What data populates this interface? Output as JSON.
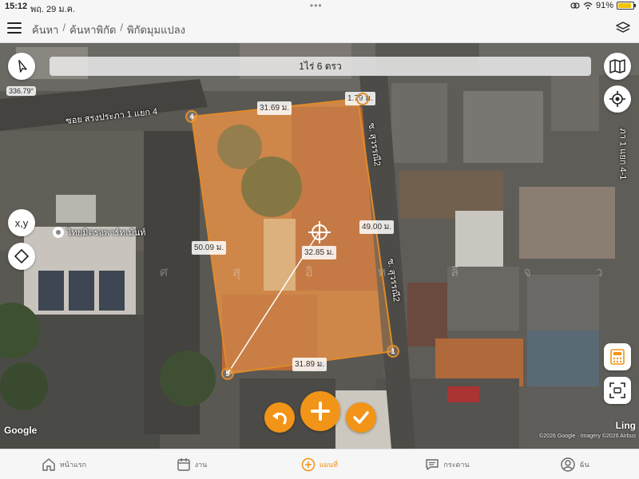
{
  "status_bar": {
    "time": "15:12",
    "date": "พฤ. 29 ม.ค.",
    "battery": "91%"
  },
  "nav": {
    "breadcrumb": [
      "ค้นหา",
      "ค้นหาพิกัด",
      "พิกัดมุมแปลง"
    ],
    "separator": "/"
  },
  "map": {
    "area_text": "1ไร่  6 ตรว",
    "heading": "336.79°",
    "xy_label": "x,y",
    "poi_label": "ไทยมิตรอพาร์ทเม้นท์",
    "streets": {
      "top_left": "ซอย สรงประภา 1 แยก 4",
      "right_upper": "ซ. สุวรรณี2",
      "right_lower": "ซ. สุวรรณี2",
      "far_right": "ภา 1 แยก 4-1"
    },
    "measurements": {
      "top": "31.69 ม.",
      "top_right": "1.79 ม.",
      "right": "49.00 ม.",
      "left": "50.09 ม.",
      "diagonal": "32.85 ม.",
      "bottom": "31.89 ม."
    },
    "vertices": [
      "4",
      "1",
      "5"
    ],
    "attribution_logo": "Google",
    "attribution_text": "©2026 Google · Imagery ©2026 Airbus",
    "corner_label": "Ling"
  },
  "tabs": [
    {
      "label": "หน้าแรก",
      "icon": "home-icon"
    },
    {
      "label": "งาน",
      "icon": "calendar-icon"
    },
    {
      "label": "แผนที่",
      "icon": "plus-circle-icon"
    },
    {
      "label": "กระดาน",
      "icon": "chat-icon"
    },
    {
      "label": "ฉัน",
      "icon": "user-icon"
    }
  ],
  "colors": {
    "accent": "#f29417",
    "polygon_stroke": "#e08a2a",
    "polygon_fill": "#e6a45c"
  }
}
